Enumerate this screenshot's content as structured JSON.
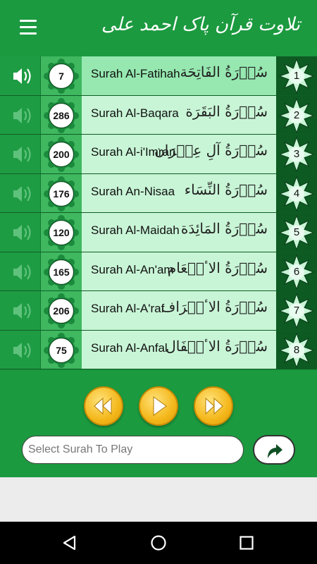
{
  "header": {
    "title": "تلاوت قرآن پاک احمد علی"
  },
  "colors": {
    "primary": "#1b9a3f",
    "row_bg": "#c8f5d6",
    "row_active_bg": "#96e8b0",
    "number_col_bg": "#0d5a23",
    "gold": "#f4b71a"
  },
  "surahs": [
    {
      "number": "1",
      "name": "Surah Al-Fatihah",
      "arabic": "سُوۡرَةُ الفَاتِحَة",
      "ayat": "7",
      "playing": true
    },
    {
      "number": "2",
      "name": "Surah Al-Baqara",
      "arabic": "سُوۡرَةُ البَقَرَة",
      "ayat": "286",
      "playing": false
    },
    {
      "number": "3",
      "name": "Surah Al-i'Imran",
      "arabic": "سُوۡرَةُ آلِ عِمۡرَان",
      "ayat": "200",
      "playing": false
    },
    {
      "number": "4",
      "name": "Surah An-Nisaa",
      "arabic": "سُوۡرَةُ النِّسَاء",
      "ayat": "176",
      "playing": false
    },
    {
      "number": "5",
      "name": "Surah Al-Maidah",
      "arabic": "سُوۡرَةُ المَائِدَة",
      "ayat": "120",
      "playing": false
    },
    {
      "number": "6",
      "name": "Surah Al-An'am",
      "arabic": "سُوۡرَةُ الاٴنۡعَام",
      "ayat": "165",
      "playing": false
    },
    {
      "number": "7",
      "name": "Surah Al-A'raf",
      "arabic": "سُوۡرَةُ الاٴعۡرَاف",
      "ayat": "206",
      "playing": false
    },
    {
      "number": "8",
      "name": "Surah Al-Anfal",
      "arabic": "سُوۡرَةُ الاٴنۡفَال",
      "ayat": "75",
      "playing": false
    }
  ],
  "player": {
    "rewind_icon": "rewind-icon",
    "play_icon": "play-icon",
    "forward_icon": "fast-forward-icon",
    "select_placeholder": "Select Surah To Play",
    "go_icon": "curved-arrow-icon"
  },
  "navbar": {
    "back_icon": "back-triangle-icon",
    "home_icon": "home-circle-icon",
    "recents_icon": "recents-square-icon"
  }
}
